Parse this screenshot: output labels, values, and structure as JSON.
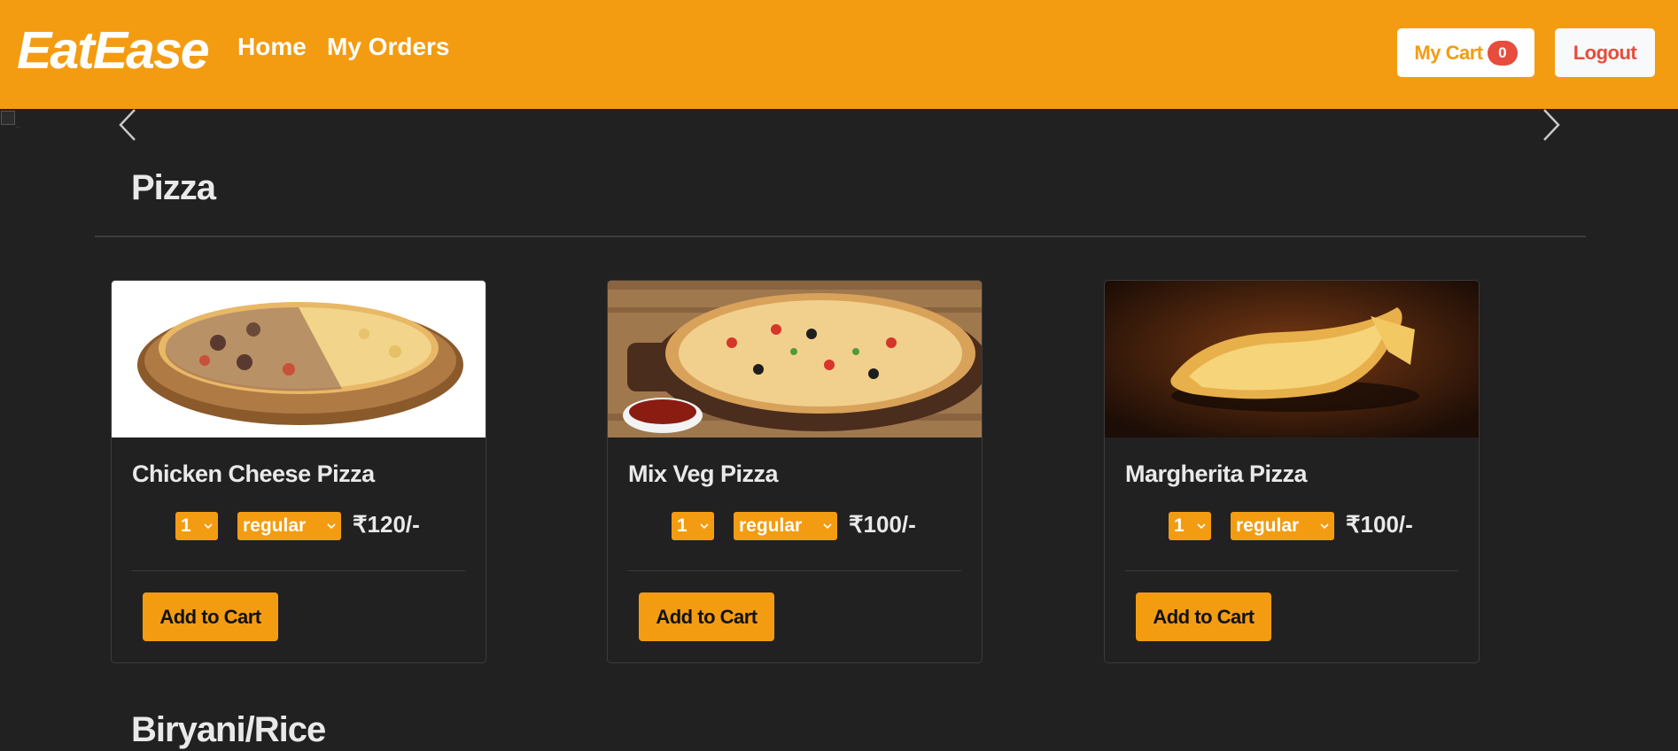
{
  "navbar": {
    "brand": "EatEase",
    "links": [
      {
        "label": "Home"
      },
      {
        "label": "My Orders"
      }
    ],
    "cart_label": "My Cart",
    "cart_count": "0",
    "logout_label": "Logout"
  },
  "sections": [
    {
      "title": "Pizza",
      "items": [
        {
          "name": "Chicken Cheese Pizza",
          "qty": "1",
          "size": "regular",
          "price": "₹120/-",
          "add_label": "Add to Cart"
        },
        {
          "name": "Mix Veg Pizza",
          "qty": "1",
          "size": "regular",
          "price": "₹100/-",
          "add_label": "Add to Cart"
        },
        {
          "name": "Margherita Pizza",
          "qty": "1",
          "size": "regular",
          "price": "₹100/-",
          "add_label": "Add to Cart"
        }
      ]
    },
    {
      "title": "Biryani/Rice"
    }
  ],
  "colors": {
    "accent": "#f39c12",
    "background": "#212121",
    "badge": "#e74c3c",
    "logout_text": "#e74c3c"
  },
  "icons": [
    "chevron-left-icon",
    "chevron-right-icon",
    "chevron-down-icon",
    "broken-image-icon"
  ]
}
